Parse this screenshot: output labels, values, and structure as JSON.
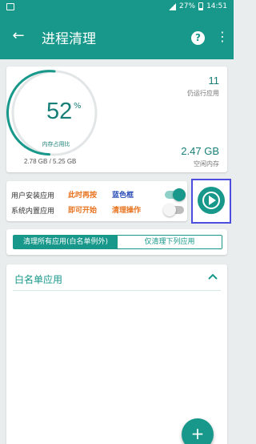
{
  "status_bar": {
    "battery": "27%",
    "time": "14:51"
  },
  "appbar": {
    "title": "进程清理"
  },
  "memory": {
    "percent": "52",
    "percent_sign": "%",
    "percent_fraction": 0.52,
    "label": "内存占用比",
    "usage": "2.78 GB / 5.25 GB",
    "running_count": "11",
    "running_label": "仍运行应用",
    "free_value": "2.47 GB",
    "free_label": "空闲内存"
  },
  "toggles": {
    "user_apps_label": "用户安装应用",
    "system_apps_label": "系统内置应用",
    "note1_a": "此时再按",
    "note1_b": "蓝色框",
    "note2_a": "即可开始",
    "note2_b": "清理操作",
    "user_apps_on": true,
    "system_apps_on": false
  },
  "segments": {
    "all": "清理所有应用(白名单例外)",
    "only": "仅清理下列应用"
  },
  "whitelist": {
    "title": "白名单应用"
  },
  "fab": {
    "label": "+"
  },
  "colors": {
    "accent": "#17988a",
    "highlight_box": "#4d4de0",
    "note_orange": "#e8721d",
    "note_blue": "#2d4fb8"
  },
  "icons": {
    "back": "arrow-left-icon",
    "help": "help-icon",
    "more": "more-vert-icon",
    "play": "play-circle-icon",
    "chevron": "chevron-up-icon"
  }
}
